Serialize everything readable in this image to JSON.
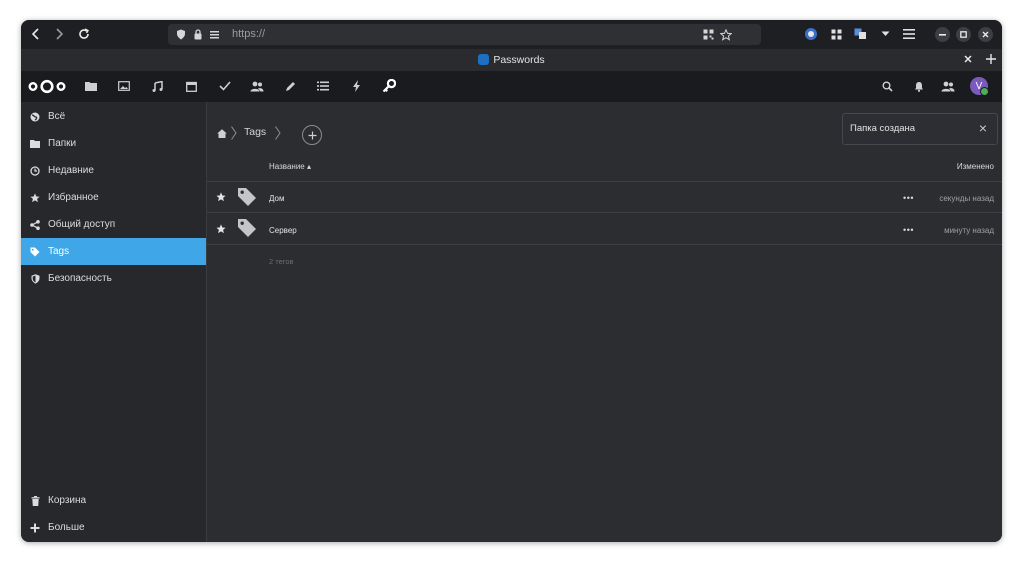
{
  "browser": {
    "url": "https://",
    "tab_title": "Passwords"
  },
  "header": {
    "user_initial": "V"
  },
  "sidebar": {
    "items": [
      {
        "label": "Всё",
        "icon": "globe-icon"
      },
      {
        "label": "Папки",
        "icon": "folder-icon"
      },
      {
        "label": "Недавние",
        "icon": "clock-icon"
      },
      {
        "label": "Избранное",
        "icon": "star-icon"
      },
      {
        "label": "Общий доступ",
        "icon": "share-icon"
      },
      {
        "label": "Tags",
        "icon": "tag-icon",
        "active": true
      },
      {
        "label": "Безопасность",
        "icon": "shield-icon"
      }
    ],
    "bottom": [
      {
        "label": "Корзина",
        "icon": "trash-icon"
      },
      {
        "label": "Больше",
        "icon": "plus-icon"
      }
    ]
  },
  "breadcrumb": {
    "current": "Tags"
  },
  "table": {
    "col_name": "Название ▴",
    "col_modified": "Изменено",
    "rows": [
      {
        "name": "Дом",
        "modified": "секунды назад"
      },
      {
        "name": "Сервер",
        "modified": "минуту назад"
      }
    ],
    "footer": "2 тегов",
    "more_label": "•••"
  },
  "toast": {
    "text": "Папка создана",
    "close": "×"
  },
  "colors": {
    "accent": "#3fa7e8",
    "header_bg": "#1a1b1e",
    "sidebar_bg": "#26282c",
    "content_bg": "#2b2d31"
  }
}
